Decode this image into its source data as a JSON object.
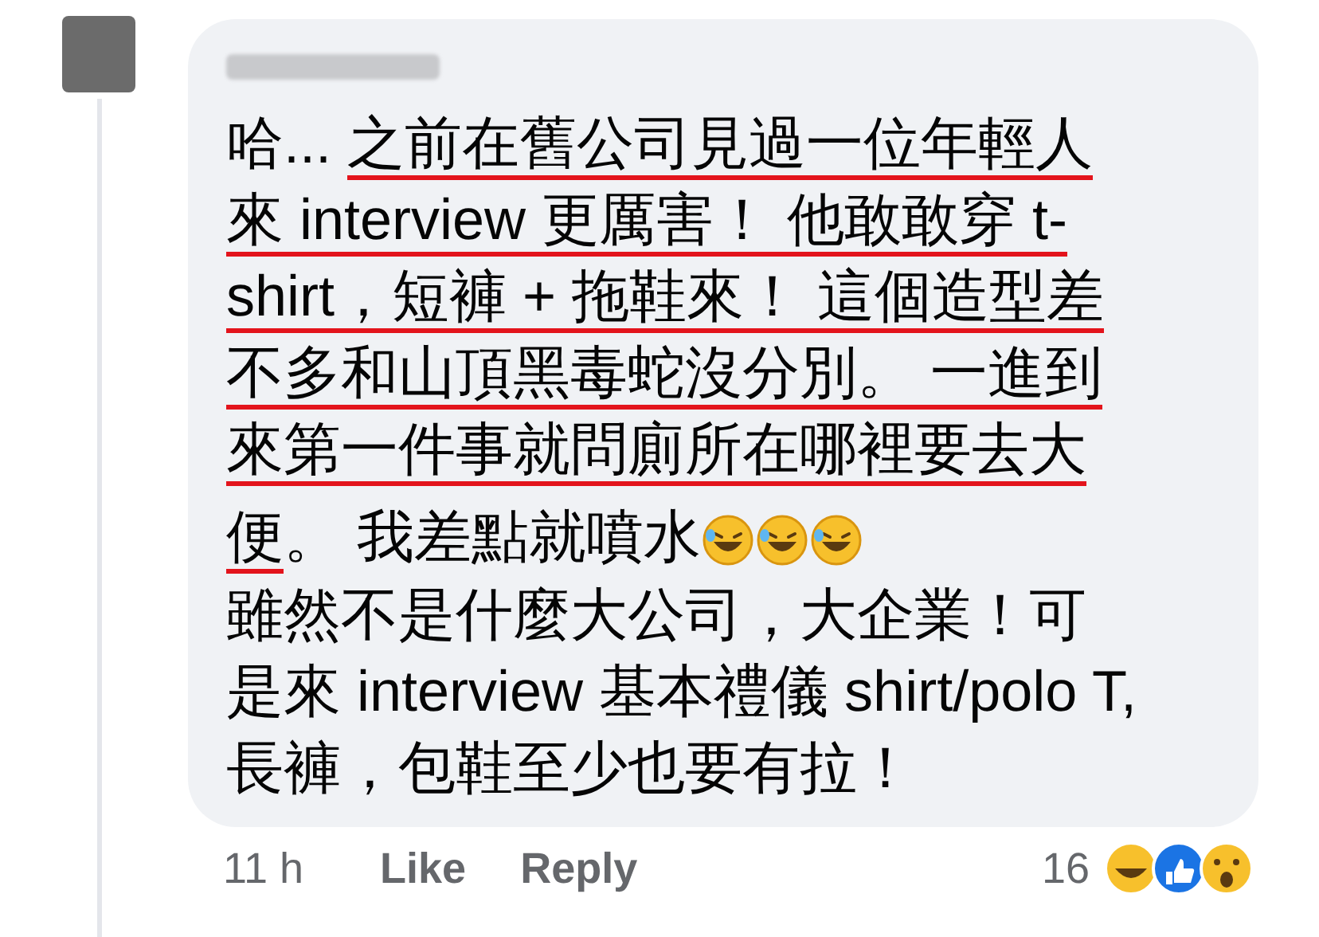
{
  "comment": {
    "paragraphs": [
      {
        "lines": [
          {
            "segments": [
              {
                "text": "哈... ",
                "underlined": false
              },
              {
                "text": "之前在舊公司見過一位年輕人",
                "underlined": true
              }
            ]
          },
          {
            "segments": [
              {
                "text": "來 interview 更厲害！ 他敢敢穿 t-",
                "underlined": true
              }
            ]
          },
          {
            "segments": [
              {
                "text": "shirt，短褲 + 拖鞋來！ 這個造型差",
                "underlined": true
              }
            ]
          },
          {
            "segments": [
              {
                "text": "不多和山頂黑毒蛇沒分別。 一進到",
                "underlined": true
              }
            ]
          },
          {
            "segments": [
              {
                "text": "來第一件事就問廁所在哪裡要去大",
                "underlined": true
              }
            ]
          },
          {
            "segments": [
              {
                "text": "便",
                "underlined": true
              },
              {
                "text": "。 我差點就噴水",
                "underlined": false
              }
            ]
          }
        ],
        "emoji_after": true
      },
      {
        "lines": [
          {
            "segments": [
              {
                "text": "雖然不是什麼大公司，大企業！可",
                "underlined": false
              }
            ]
          },
          {
            "segments": [
              {
                "text": "是來 interview 基本禮儀 shirt/polo T,",
                "underlined": false
              }
            ]
          },
          {
            "segments": [
              {
                "text": "長褲，包鞋至少也要有拉！",
                "underlined": false
              }
            ]
          }
        ]
      }
    ]
  },
  "footer": {
    "time": "11 h",
    "actions": [
      "Like",
      "Reply"
    ],
    "reaction_count": "16"
  }
}
